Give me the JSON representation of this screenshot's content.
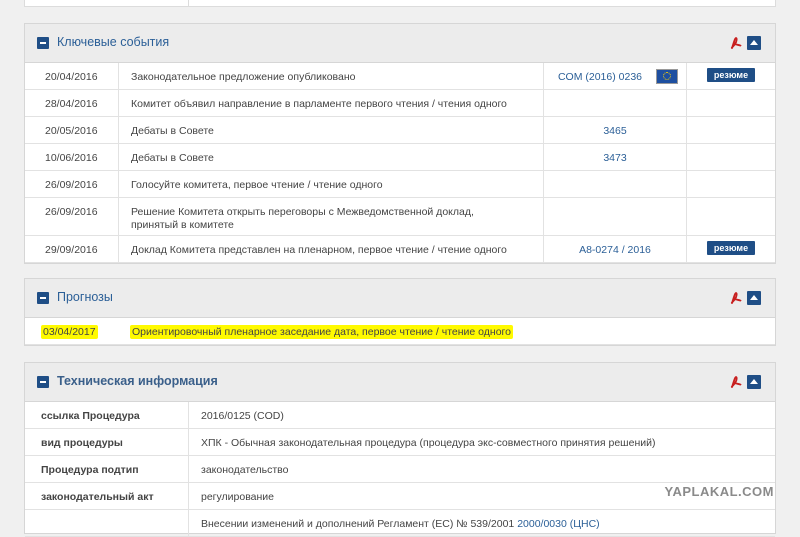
{
  "key_events": {
    "title": "Ключевые события",
    "rows": [
      {
        "date": "20/04/2016",
        "text": "Законодательное предложение опубликовано",
        "ref": "COM (2016) 0236",
        "summary": "резюме"
      },
      {
        "date": "28/04/2016",
        "text": "Комитет объявил направление в парламенте первого чтения / чтения одного",
        "ref": "",
        "summary": ""
      },
      {
        "date": "20/05/2016",
        "text": "Дебаты в Совете",
        "ref": "3465",
        "summary": ""
      },
      {
        "date": "10/06/2016",
        "text": "Дебаты в Совете",
        "ref": "3473",
        "summary": ""
      },
      {
        "date": "26/09/2016",
        "text": "Голосуйте комитета, первое чтение / чтение одного",
        "ref": "",
        "summary": ""
      },
      {
        "date": "26/09/2016",
        "text": "Решение Комитета открыть переговоры с Межведомственной доклад, принятый в комитете",
        "ref": "",
        "summary": ""
      },
      {
        "date": "29/09/2016",
        "text": "Доклад Комитета представлен на пленарном, первое чтение / чтение одного",
        "ref": "A8-0274 / 2016",
        "summary": "резюме"
      }
    ]
  },
  "forecasts": {
    "title": "Прогнозы",
    "rows": [
      {
        "date": "03/04/2017",
        "text": "Ориентировочный пленарное заседание дата, первое чтение / чтение одного"
      }
    ]
  },
  "tech_info": {
    "title": "Техническая информация",
    "rows": [
      {
        "key": "ссылка Процедура",
        "value": "2016/0125 (COD)"
      },
      {
        "key": "вид процедуры",
        "value": "ХПК - Обычная законодательная процедура (процедура экс-совместного принятия решений)"
      },
      {
        "key": "Процедура подтип",
        "value": "законодательство"
      },
      {
        "key": "законодательный акт",
        "value": "регулирование"
      },
      {
        "key": "",
        "value": "Внесении изменений и дополнений Регламент (ЕС) № 539/2001",
        "link": "2000/0030 (ЦНС)"
      }
    ]
  },
  "watermark": "YAPLAKAL.COM",
  "colors": {
    "accent": "#1f4e86",
    "link": "#2b5f97",
    "highlight": "#fffa00"
  },
  "icons": [
    "collapse-icon",
    "pdf-icon",
    "collapse-up-icon",
    "eu-flag-icon"
  ]
}
